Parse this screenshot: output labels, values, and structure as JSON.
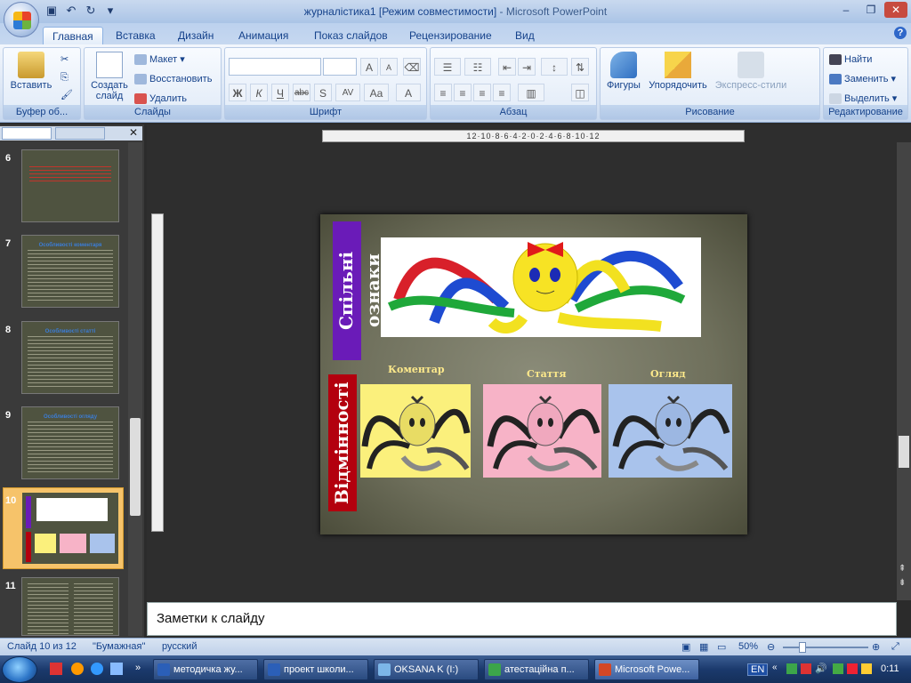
{
  "window": {
    "title": "журналістика1 [Режим совместимости]",
    "app_suffix": " - Microsoft PowerPoint"
  },
  "ribbon_tabs": [
    "Главная",
    "Вставка",
    "Дизайн",
    "Анимация",
    "Показ слайдов",
    "Рецензирование",
    "Вид"
  ],
  "ribbon": {
    "clipboard": {
      "title": "Буфер об...",
      "paste": "Вставить"
    },
    "slides": {
      "title": "Слайды",
      "create": "Создать",
      "create2": "слайд",
      "layout": "Макет",
      "restore": "Восстановить",
      "delete": "Удалить"
    },
    "font": {
      "title": "Шрифт",
      "bold": "Ж",
      "italic": "К",
      "underline": "Ч",
      "strike": "abc",
      "shadow": "S",
      "spacing": "AV",
      "case": "Aa",
      "color": "A",
      "grow": "A",
      "shrink": "A"
    },
    "paragraph": {
      "title": "Абзац"
    },
    "drawing": {
      "title": "Рисование",
      "shapes": "Фигуры",
      "arrange": "Упорядочить",
      "styles": "Экспресс-стили"
    },
    "editing": {
      "title": "Редактирование",
      "find": "Найти",
      "replace": "Заменить",
      "select": "Выделить"
    }
  },
  "thumbnails": [
    {
      "num": "6"
    },
    {
      "num": "7",
      "title": "Особливості коментаря"
    },
    {
      "num": "8",
      "title": "Особливості статті"
    },
    {
      "num": "9",
      "title": "Особливості огляду"
    },
    {
      "num": "10"
    },
    {
      "num": "11"
    }
  ],
  "ruler": {
    "horizontal": "12·10·8·6·4·2·0·2·4·6·8·10·12"
  },
  "slide": {
    "common_title": "Спільні ознаки",
    "diff_title": "Відмінності",
    "labels": [
      "Коментар",
      "Стаття",
      "Огляд"
    ],
    "colors": {
      "purple": "#6a1bb8",
      "red": "#b3000e",
      "yellow": "#fbf07c",
      "pink": "#f7b3c7",
      "blue": "#a9c3ec"
    }
  },
  "notes": {
    "placeholder": "Заметки к слайду"
  },
  "status": {
    "slide": "Слайд 10 из 12",
    "theme": "\"Бумажная\"",
    "lang": "русский",
    "zoom": "50%"
  },
  "taskbar": {
    "items": [
      "методичка жу...",
      "проект школи...",
      "OKSANA K (I:)",
      "атестаційна п...",
      "Microsoft Powe..."
    ],
    "lang": "EN",
    "clock": "0:11"
  }
}
